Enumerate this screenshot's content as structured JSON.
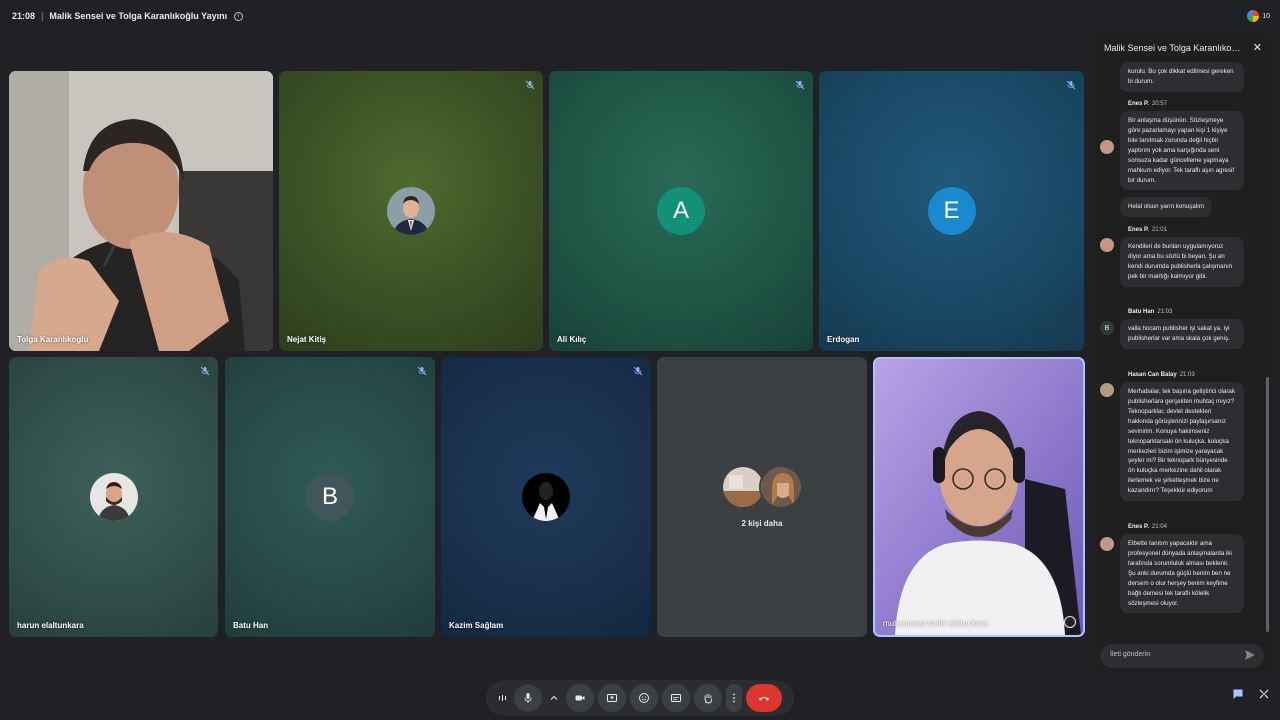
{
  "topbar": {
    "time": "21:08",
    "separator": "|",
    "meeting_title": "Malik Sensei ve Tolga Karanlıkoğlu Yayını",
    "info_icon": "info-icon",
    "participant_count": "10"
  },
  "tiles": [
    {
      "name": "Tolga Karanlıkoglu",
      "type": "video"
    },
    {
      "name": "Nejat Kitiş",
      "type": "avatar-photo",
      "muted": true
    },
    {
      "name": "Ali Kılıç",
      "type": "letter",
      "letter": "A",
      "color": "#129178",
      "muted": true
    },
    {
      "name": "Erdogan",
      "type": "letter",
      "letter": "E",
      "color": "#1a8ad0",
      "muted": true
    },
    {
      "name": "harun elaltunkara",
      "type": "avatar-photo",
      "muted": true
    },
    {
      "name": "Batu Han",
      "type": "letter",
      "letter": "B",
      "color": "#40565a",
      "muted": true
    },
    {
      "name": "Kazim Sağlam",
      "type": "avatar-photo",
      "muted": true
    },
    {
      "name": "2 kişi daha",
      "type": "more"
    },
    {
      "name": "muhammed malik elaltunkara",
      "type": "video"
    }
  ],
  "chat": {
    "title": "Malik Sensei ve Tolga Karanlıkoğl...",
    "close_icon": "close-icon",
    "messages": [
      {
        "sender": "",
        "time": "",
        "text": "kurulu. Bu çok dikkat edilmesi gereken bi durum."
      },
      {
        "sender": "Enes P.",
        "time": "20:57",
        "text": "Bir anlaşma düşünün. Sözleşmeye göre pazarlamayı yapan kişi 1 kişiye bile tanıtmak zorunda değil hiçbir yaptırım yok ama karşığında seni sonsuza kadar güncelleme yapmaya mahkum ediyor. Tek taraflı aşırı agresif bir durum."
      },
      {
        "sender": "",
        "time": "",
        "text": "Helal olsun yarın konuşalım"
      },
      {
        "sender": "Enes P.",
        "time": "21:01",
        "text": "Kendileri de bunları uygulamıyoruz diyor ama bu sözlü bi beyan. Şu an kendi durumda publisherla çalışmanın pek bir mantığı kalmıyor gibi."
      },
      {
        "sender": "Batu Han",
        "time": "21:03",
        "text": "valla hocam publisher işi sakat ya. iyi publisherlar var ama skala çok geniş.",
        "avatar_letter": "B"
      },
      {
        "sender": "Hasan Can Balay",
        "time": "21:03",
        "text": "Merhabalar, tek başına geliştirici olarak publisherlara gerçekten muhtaç mıyız? Teknoparklar, devlet destekleri hakkında görüşlerinizi paylaşırsanız sevinirim. Konuya hakimseniz teknoparklarsaki ön kuluçka, kuluçka merkezleri bizim işimize yarayacak şeyler mi? Bir teknopark bünyesinde ön kuluçka merkezine dahil olarak ilerlemek ve şirketleşmek bize ne kazandırır? Teşekkür ediyorum"
      },
      {
        "sender": "Enes P.",
        "time": "21:04",
        "text": "Elbette tanıtım yapacaktır ama profesyonel dünyada anlaşmalarda iki tarafında sorumluluk alması beklenir. Şu anki durumda güçlü benim ben ne dersem o olur herşey benim keyfime bağlı demesi tek taraflı kölelik sözleşmesi oluyor."
      }
    ],
    "input_placeholder": "İleti gönderin",
    "send_icon": "send-icon"
  },
  "controls": [
    {
      "name": "audio-bars-icon"
    },
    {
      "name": "microphone-icon"
    },
    {
      "name": "chevron-up-icon"
    },
    {
      "name": "camera-icon"
    },
    {
      "name": "present-icon"
    },
    {
      "name": "emoji-icon"
    },
    {
      "name": "captions-icon"
    },
    {
      "name": "raise-hand-icon"
    },
    {
      "name": "more-options-icon"
    },
    {
      "name": "end-call-icon"
    }
  ],
  "bottom_right": [
    "chat-icon",
    "activities-icon"
  ]
}
